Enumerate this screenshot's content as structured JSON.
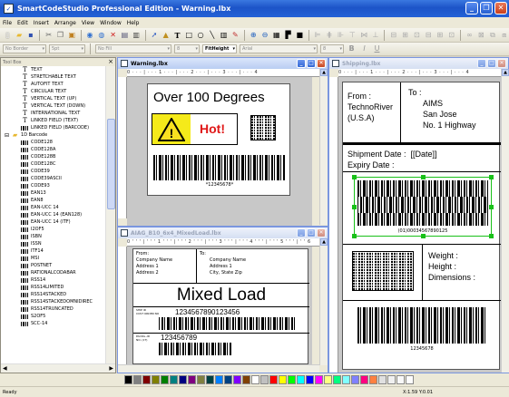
{
  "app": {
    "title": "SmartCodeStudio Professional Edition - Warning.lbx"
  },
  "menu": [
    "File",
    "Edit",
    "Insert",
    "Arrange",
    "View",
    "Window",
    "Help"
  ],
  "toolbar2": {
    "border_style": "No Border",
    "line_width": "5pt",
    "fill": "No Fill",
    "size": "8",
    "height_mode": "FitHeight",
    "font": "Arial",
    "font_size": "8"
  },
  "toolbox": {
    "title": "Tool Box",
    "items": [
      {
        "label": "TEXT",
        "icon": "text"
      },
      {
        "label": "STRETCHABLE TEXT",
        "icon": "text"
      },
      {
        "label": "AUTOFIT TEXT",
        "icon": "text"
      },
      {
        "label": "CIRCULAR TEXT",
        "icon": "text"
      },
      {
        "label": "VERTICAL TEXT (UP)",
        "icon": "text"
      },
      {
        "label": "VERTICAL TEXT (DOWN)",
        "icon": "text"
      },
      {
        "label": "INTERNATIONAL TEXT",
        "icon": "text"
      },
      {
        "label": "LINKED FIELD (TEXT)",
        "icon": "text"
      },
      {
        "label": "LINKED FIELD (BARCODE)",
        "icon": "barcode"
      },
      {
        "label": "1D Barcode",
        "icon": "folder"
      },
      {
        "label": "CODE128",
        "icon": "barcode"
      },
      {
        "label": "CODE128A",
        "icon": "barcode"
      },
      {
        "label": "CODE128B",
        "icon": "barcode"
      },
      {
        "label": "CODE128C",
        "icon": "barcode"
      },
      {
        "label": "CODE39",
        "icon": "barcode"
      },
      {
        "label": "CODE39ASCII",
        "icon": "barcode"
      },
      {
        "label": "CODE93",
        "icon": "barcode"
      },
      {
        "label": "EAN13",
        "icon": "barcode"
      },
      {
        "label": "EAN8",
        "icon": "barcode"
      },
      {
        "label": "EAN-UCC 14",
        "icon": "barcode"
      },
      {
        "label": "EAN-UCC 14 (EAN128)",
        "icon": "barcode"
      },
      {
        "label": "EAN-UCC 14 (ITF)",
        "icon": "barcode"
      },
      {
        "label": "I2OF5",
        "icon": "barcode"
      },
      {
        "label": "ISBN",
        "icon": "barcode"
      },
      {
        "label": "ISSN",
        "icon": "barcode"
      },
      {
        "label": "ITF14",
        "icon": "barcode"
      },
      {
        "label": "MSI",
        "icon": "barcode"
      },
      {
        "label": "POSTNET",
        "icon": "barcode"
      },
      {
        "label": "RATIONALCODABAR",
        "icon": "barcode"
      },
      {
        "label": "RSS14",
        "icon": "barcode"
      },
      {
        "label": "RSS14LIMITED",
        "icon": "barcode"
      },
      {
        "label": "RSS14STACKED",
        "icon": "barcode"
      },
      {
        "label": "RSS14STACKEDOMNIDIREC",
        "icon": "barcode"
      },
      {
        "label": "RSS14TRUNCATED",
        "icon": "barcode"
      },
      {
        "label": "S2OF5",
        "icon": "barcode"
      },
      {
        "label": "SCC-14",
        "icon": "barcode"
      }
    ]
  },
  "windows": {
    "warning": {
      "title": "Warning.lbx",
      "heading": "Over 100 Degrees",
      "hot": "Hot!",
      "barcode_text": "*12345678*"
    },
    "aiag": {
      "title": "AIAG_B10_6x4_MixedLoad.lbx",
      "from_label": "From:",
      "from_lines": [
        "Company Name",
        "Address 1",
        "Address 2"
      ],
      "to_label": "To:",
      "to_lines": [
        "Company Name",
        "Address 1",
        "City, State Zip"
      ],
      "heading": "Mixed Load",
      "mid_label_1": "SHIP ID",
      "mid_label_2": "CUST ORDER NO",
      "mid_number": "1234567890123456",
      "bottom_label": "PACKG.-ID NO. (1T)",
      "bottom_number": "123456789"
    },
    "shipping": {
      "title": "Shipping.lbx",
      "from_label": "From :",
      "from_lines": [
        "TechnoRiver",
        "(U.S.A)"
      ],
      "to_label": "To :",
      "to_lines": [
        "AIMS",
        "San Jose",
        "No. 1 Highway"
      ],
      "shipment_line": "Shipment Date :  [[Date]]",
      "expiry_line": "Expiry Date :",
      "rss_text": "(01)00034567890125",
      "weight": "Weight :",
      "height": "Height :",
      "dimensions": "Dimensions :",
      "barcode_text": "12345678"
    }
  },
  "ruler_top": "0 · · · | · · · 1 · · · | · · · 2 · · · | · · · 3 · · · | · · · 4",
  "ruler_top_mid": "0 ' ' ' | ' ' ' 1 ' ' ' | ' ' ' 2 ' ' ' | ' ' ' 3 ' ' ' | ' ' ' 4 ' ' ' | ' ' ' 5 ' ' ' | ' ' 6",
  "palette": [
    "#000000",
    "#808080",
    "#800000",
    "#808000",
    "#008000",
    "#008080",
    "#000080",
    "#800080",
    "#808040",
    "#004040",
    "#0080ff",
    "#004080",
    "#8000ff",
    "#804000",
    "#ffffff",
    "#c0c0c0",
    "#ff0000",
    "#ffff00",
    "#00ff00",
    "#00ffff",
    "#0000ff",
    "#ff00ff",
    "#ffff80",
    "#00ff80",
    "#80ffff",
    "#8080ff",
    "#ff0080",
    "#ff8040",
    "#e0e0e0",
    "#f0f0f0",
    "#f8f8f8",
    "#fcfcfc"
  ],
  "status": {
    "left": "Ready",
    "coords": "X:1.59  Y:0.01"
  }
}
